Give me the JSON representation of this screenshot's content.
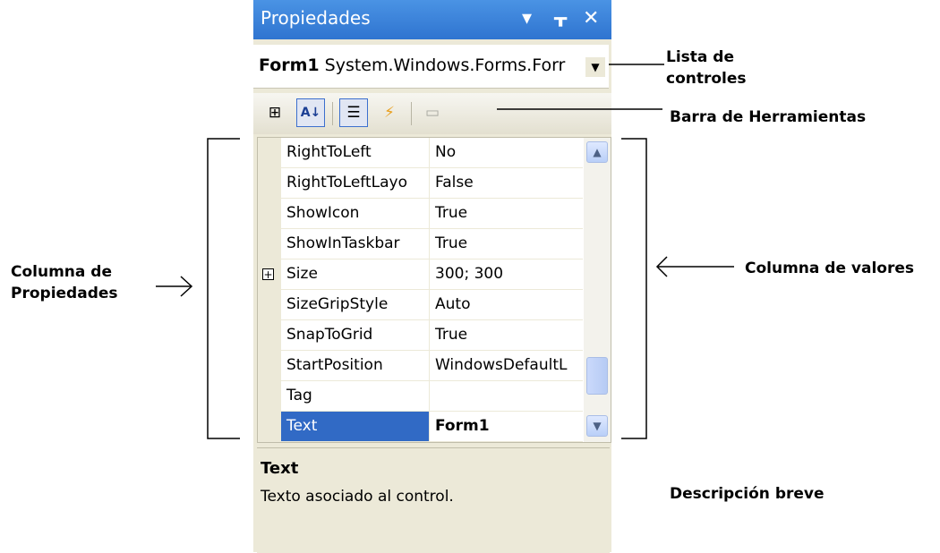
{
  "panel": {
    "title": "Propiedades",
    "buttons": {
      "dropdown": "▾",
      "pin": "ᚁ",
      "close": "✕"
    }
  },
  "object_selector": {
    "object_name": "Form1",
    "object_type": "System.Windows.Forms.Forr",
    "arrow": "▼"
  },
  "toolbar": {
    "tools": [
      {
        "name": "categorized-icon",
        "glyph": "⊞",
        "active": false
      },
      {
        "name": "alphabetical-icon",
        "glyph": "A↓",
        "active": true
      },
      {
        "name": "properties-icon",
        "glyph": "☰",
        "active": true
      },
      {
        "name": "events-icon",
        "glyph": "⚡",
        "active": false
      },
      {
        "name": "property-pages-icon",
        "glyph": "▭",
        "active": false
      }
    ]
  },
  "grid": {
    "rows": [
      {
        "name": "RightToLeft",
        "value": "No"
      },
      {
        "name": "RightToLeftLayo",
        "value": "False"
      },
      {
        "name": "ShowIcon",
        "value": "True"
      },
      {
        "name": "ShowInTaskbar",
        "value": "True"
      },
      {
        "name": "Size",
        "value": "300; 300",
        "expandable": true
      },
      {
        "name": "SizeGripStyle",
        "value": "Auto"
      },
      {
        "name": "SnapToGrid",
        "value": "True"
      },
      {
        "name": "StartPosition",
        "value": "WindowsDefaultL"
      },
      {
        "name": "Tag",
        "value": ""
      },
      {
        "name": "Text",
        "value": "Form1",
        "selected": true
      }
    ],
    "expand_glyph": "+",
    "scroll_up": "▲",
    "scroll_down": "▼"
  },
  "description": {
    "title": "Text",
    "text": "Texto asociado al control."
  },
  "annotations": {
    "lista_line1": "Lista de",
    "lista_line2": "controles",
    "barra": "Barra de Herramientas",
    "columna_prop_line1": "Columna de",
    "columna_prop_line2": "Propiedades",
    "columna_valores": "Columna de valores",
    "descripcion": "Descripción breve"
  },
  "colors": {
    "titlebar": "#3c85d8",
    "selection": "#316ac5",
    "panel_bg": "#ece9d8"
  }
}
